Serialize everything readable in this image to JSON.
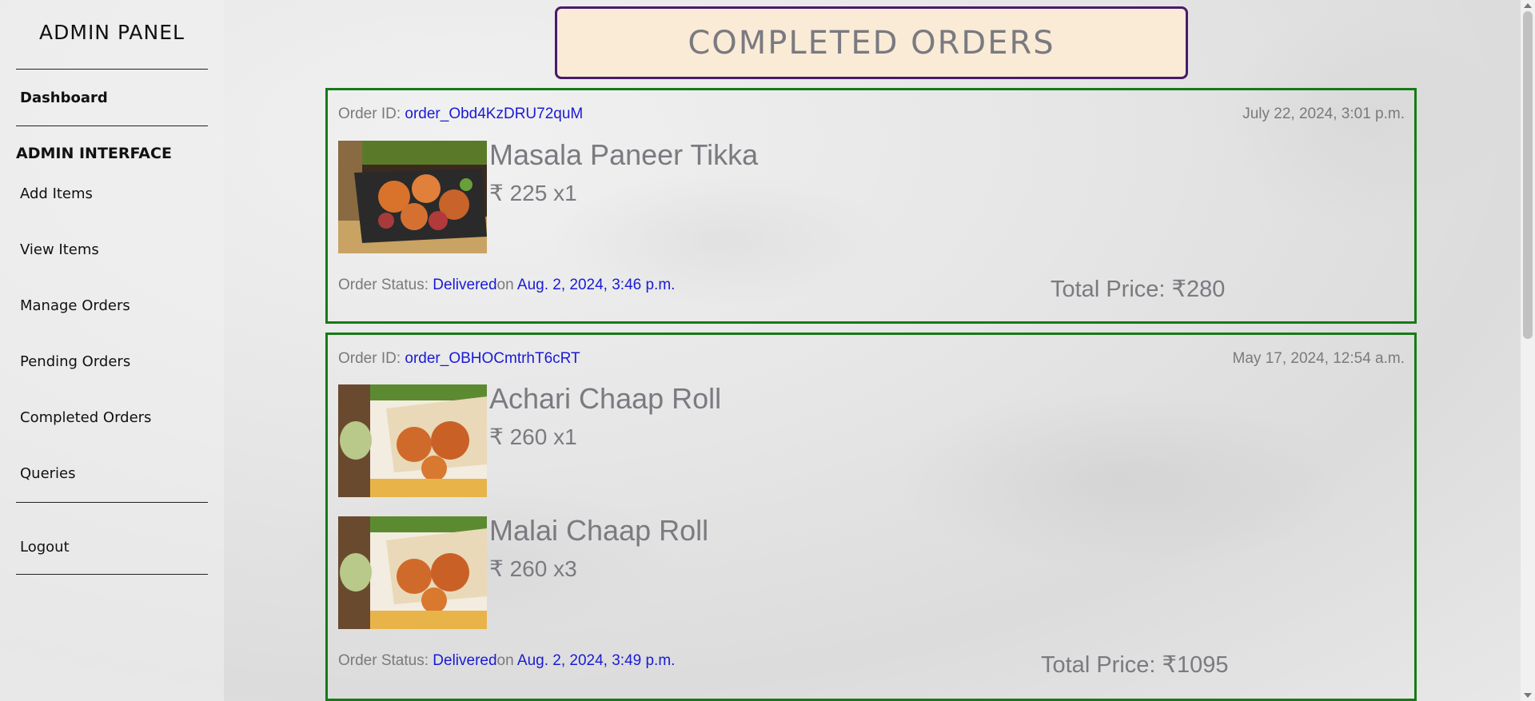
{
  "sidebar": {
    "brand": "ADMIN PANEL",
    "dashboard": "Dashboard",
    "section_title": "ADMIN INTERFACE",
    "items": [
      {
        "label": "Add Items"
      },
      {
        "label": "View Items"
      },
      {
        "label": "Manage Orders"
      },
      {
        "label": "Pending Orders"
      },
      {
        "label": "Completed Orders"
      },
      {
        "label": "Queries"
      }
    ],
    "logout": "Logout"
  },
  "page": {
    "title": "COMPLETED ORDERS"
  },
  "orders": [
    {
      "id_label": "Order ID:",
      "id": "order_Obd4KzDRU72quM",
      "date": "July 22, 2024, 3:01 p.m.",
      "items": [
        {
          "name": "Masala Paneer Tikka",
          "price": "₹ 225 x1"
        }
      ],
      "status_label": "Order Status:",
      "status": "Delivered",
      "on_label": "on",
      "delivered_at": "Aug. 2, 2024, 3:46 p.m.",
      "total": "Total Price: ₹280"
    },
    {
      "id_label": "Order ID:",
      "id": "order_OBHOCmtrhT6cRT",
      "date": "May 17, 2024, 12:54 a.m.",
      "items": [
        {
          "name": "Achari Chaap Roll",
          "price": "₹ 260 x1"
        },
        {
          "name": "Malai Chaap Roll",
          "price": "₹ 260 x3"
        }
      ],
      "status_label": "Order Status:",
      "status": "Delivered",
      "on_label": "on",
      "delivered_at": "Aug. 2, 2024, 3:49 p.m.",
      "total": "Total Price: ₹1095"
    }
  ],
  "colors": {
    "card_border": "#167a16",
    "link": "#1a1ad6",
    "title_bg": "#faebd7",
    "title_border": "#4b1a6b"
  }
}
